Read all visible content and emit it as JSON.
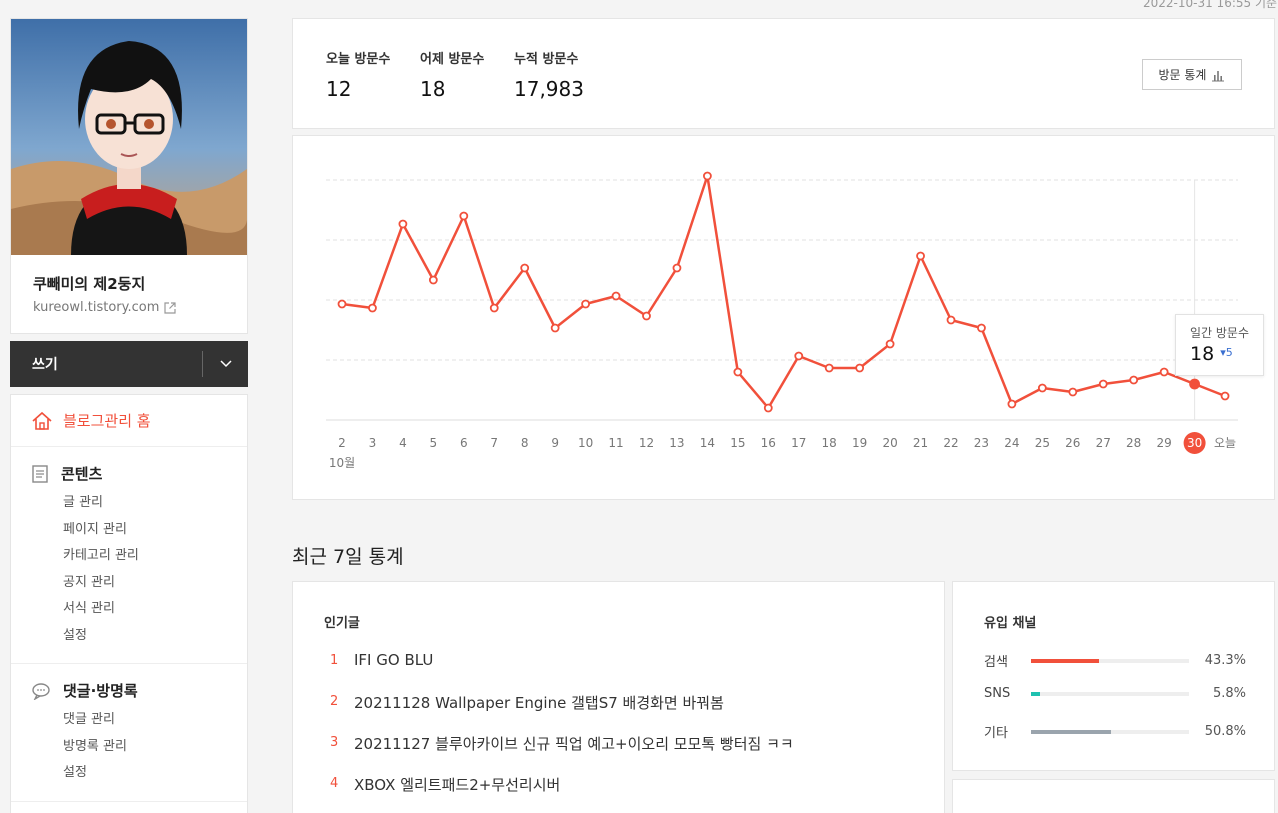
{
  "header": {
    "timestamp": "2022-10-31 16:55 기준"
  },
  "profile": {
    "blog_name": "쿠빼미의 제2둥지",
    "blog_url": "kureowl.tistory.com"
  },
  "write": {
    "label": "쓰기"
  },
  "menu": {
    "home_label": "블로그관리 홈",
    "sections": [
      {
        "title": "콘텐츠",
        "items": [
          "글 관리",
          "페이지 관리",
          "카테고리 관리",
          "공지 관리",
          "서식 관리",
          "설정"
        ]
      },
      {
        "title": "댓글·방명록",
        "items": [
          "댓글 관리",
          "방명록 관리",
          "설정"
        ]
      }
    ]
  },
  "summary": {
    "today_label": "오늘 방문수",
    "today_value": "12",
    "yesterday_label": "어제 방문수",
    "yesterday_value": "18",
    "total_label": "누적 방문수",
    "total_value": "17,983",
    "stats_button_label": "방문 통계"
  },
  "chart_data": {
    "type": "line",
    "categories": [
      "2",
      "3",
      "4",
      "5",
      "6",
      "7",
      "8",
      "9",
      "10",
      "11",
      "12",
      "13",
      "14",
      "15",
      "16",
      "17",
      "18",
      "19",
      "20",
      "21",
      "22",
      "23",
      "24",
      "25",
      "26",
      "27",
      "28",
      "29",
      "30",
      "오늘"
    ],
    "month_label": "10월",
    "values": [
      29,
      28,
      49,
      35,
      51,
      28,
      38,
      23,
      29,
      31,
      26,
      38,
      61,
      12,
      3,
      16,
      13,
      13,
      19,
      41,
      25,
      23,
      4,
      8,
      7,
      9,
      10,
      12,
      9,
      6
    ],
    "highlight_label": "30",
    "ylim": [
      0,
      60
    ],
    "grid": true,
    "color": "#f1503b",
    "tooltip": {
      "label": "일간 방문수",
      "value": "18",
      "delta": "5"
    }
  },
  "recent": {
    "section_title": "최근 7일 통계",
    "popular_title": "인기글",
    "popular": [
      {
        "rank": "1",
        "title": "IFI GO BLU"
      },
      {
        "rank": "2",
        "title": "20211128 Wallpaper Engine 갤탭S7 배경화면 바꿔봄"
      },
      {
        "rank": "3",
        "title": "20211127 블루아카이브 신규 픽업 예고+이오리 모모톡 빵터짐 ㅋㅋ"
      },
      {
        "rank": "4",
        "title": "XBOX 엘리트패드2+무선리시버"
      }
    ],
    "channel_title": "유입 채널",
    "channels": [
      {
        "name": "검색",
        "pct": "43.3%",
        "ratio": 0.433,
        "color": "#f1503b"
      },
      {
        "name": "SNS",
        "pct": "5.8%",
        "ratio": 0.058,
        "color": "#1fc1b0"
      },
      {
        "name": "기타",
        "pct": "50.8%",
        "ratio": 0.508,
        "color": "#9aa4ad"
      }
    ]
  }
}
